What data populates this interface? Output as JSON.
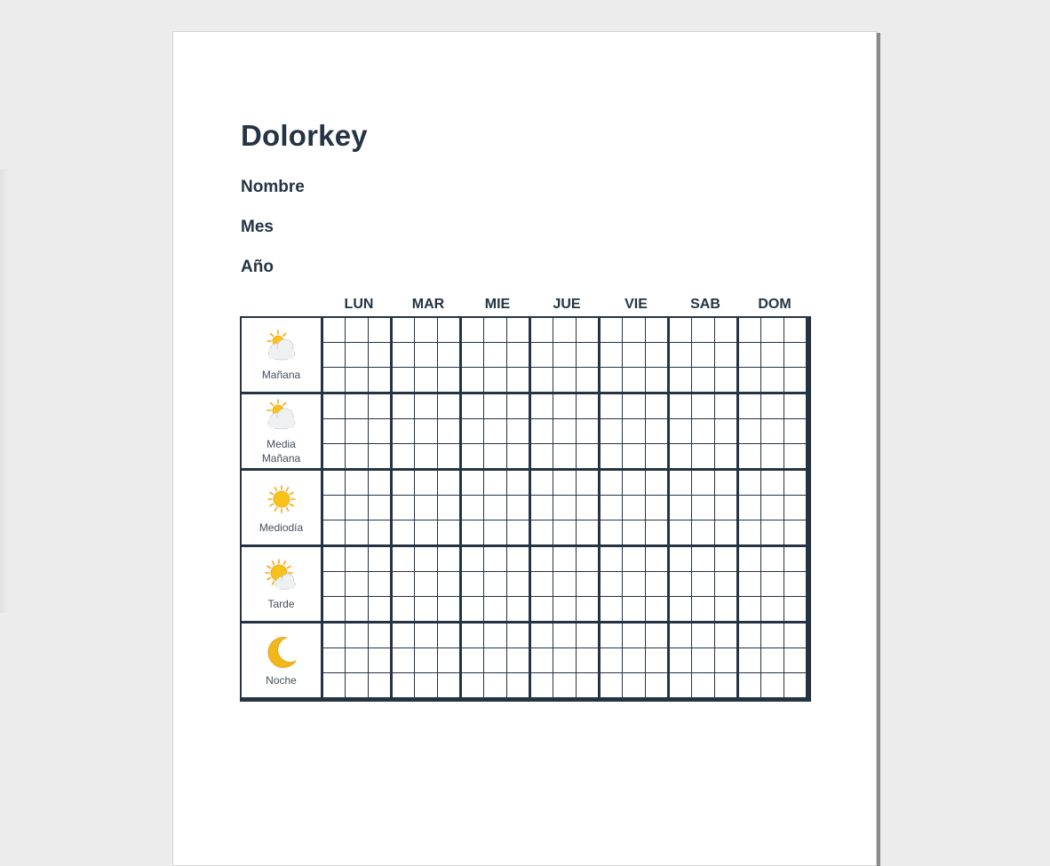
{
  "document": {
    "title": "Dolorkey",
    "fields": {
      "name_label": "Nombre",
      "month_label": "Mes",
      "year_label": "Año"
    }
  },
  "schedule": {
    "days": [
      "LUN",
      "MAR",
      "MIE",
      "JUE",
      "VIE",
      "SAB",
      "DOM"
    ],
    "periods": [
      {
        "label_line1": "Mañana",
        "label_line2": "",
        "icon": "sun-behind-cloud-icon"
      },
      {
        "label_line1": "Media",
        "label_line2": "Mañana",
        "icon": "sun-behind-cloud-icon"
      },
      {
        "label_line1": "Mediodía",
        "label_line2": "",
        "icon": "sun-icon"
      },
      {
        "label_line1": "Tarde",
        "label_line2": "",
        "icon": "sun-behind-small-cloud-icon"
      },
      {
        "label_line1": "Noche",
        "label_line2": "",
        "icon": "crescent-moon-icon"
      }
    ],
    "cells_per_block": [
      3,
      3
    ]
  },
  "colors": {
    "text_dark": "#253444",
    "grid_line": "#253444",
    "sun": "#f8c21d",
    "cloud": "#eef0f2",
    "moon": "#f2b81a"
  }
}
